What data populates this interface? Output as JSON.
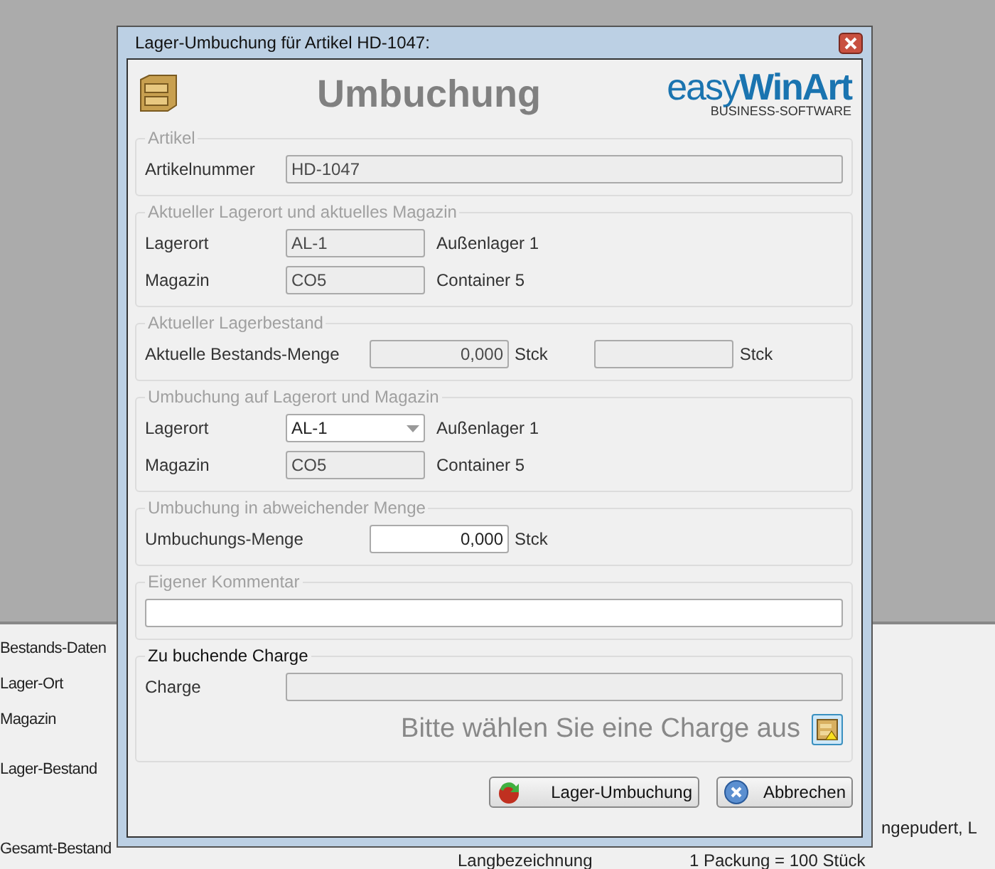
{
  "background": {
    "labels": [
      "Bestands-Daten",
      "Lager-Ort",
      "Magazin",
      "Lager-Bestand",
      "Gesamt-Bestand"
    ],
    "right_text": "ngepudert, L",
    "bottom_row": [
      "Langbezeichnung",
      "1 Packung = 100 Stück"
    ]
  },
  "dialog": {
    "title": "Lager-Umbuchung für Artikel HD-1047:",
    "heading": "Umbuchung",
    "logo": {
      "brand_light": "easy",
      "brand_bold": "WinArt",
      "tagline": "BUSINESS-SOFTWARE"
    },
    "groups": [
      {
        "title": "Artikel",
        "active": false,
        "rows": [
          {
            "kind": "wide",
            "label": "Artikelnummer",
            "value": "HD-1047",
            "disabled": true
          }
        ]
      },
      {
        "title": "Aktueller Lagerort und aktuelles Magazin",
        "active": false,
        "rows": [
          {
            "kind": "field",
            "label": "Lagerort",
            "value": "AL-1",
            "disabled": true,
            "note": "Außenlager 1"
          },
          {
            "kind": "field",
            "label": "Magazin",
            "value": "CO5",
            "disabled": true,
            "note": "Container 5"
          }
        ]
      },
      {
        "title": "Aktueller Lagerbestand",
        "active": false,
        "rows": [
          {
            "kind": "quantity",
            "label": "Aktuelle Bestands-Menge",
            "fields": [
              {
                "value": "0,000",
                "unit": "Stck",
                "disabled": true
              },
              {
                "unit": "Stck",
                "disabled": true
              }
            ]
          }
        ]
      },
      {
        "title": "Umbuchung auf Lagerort und Magazin",
        "active": false,
        "rows": [
          {
            "kind": "dropdown",
            "label": "Lagerort",
            "value": "AL-1",
            "disabled": false,
            "note": "Außenlager 1"
          },
          {
            "kind": "field",
            "label": "Magazin",
            "value": "CO5",
            "disabled": true,
            "note": "Container 5"
          }
        ]
      },
      {
        "title": "Umbuchung in abweichender Menge",
        "active": false,
        "rows": [
          {
            "kind": "quantity",
            "label": "Umbuchungs-Menge",
            "fields": [
              {
                "value": "0,000",
                "unit": "Stck",
                "disabled": false
              }
            ]
          }
        ]
      },
      {
        "title": "Eigener Kommentar",
        "active": false,
        "rows": [
          {
            "kind": "comment",
            "disabled": false
          }
        ]
      },
      {
        "title": "Zu buchende Charge",
        "active": true,
        "rows": [
          {
            "kind": "wide",
            "label": "Charge",
            "disabled": true
          },
          {
            "kind": "hint",
            "text": "Bitte wählen Sie eine Charge aus"
          }
        ]
      }
    ],
    "buttons": [
      {
        "label": "Lager-Umbuchung",
        "kind": "confirm"
      },
      {
        "label": "Abbrechen",
        "kind": "cancel"
      }
    ]
  }
}
